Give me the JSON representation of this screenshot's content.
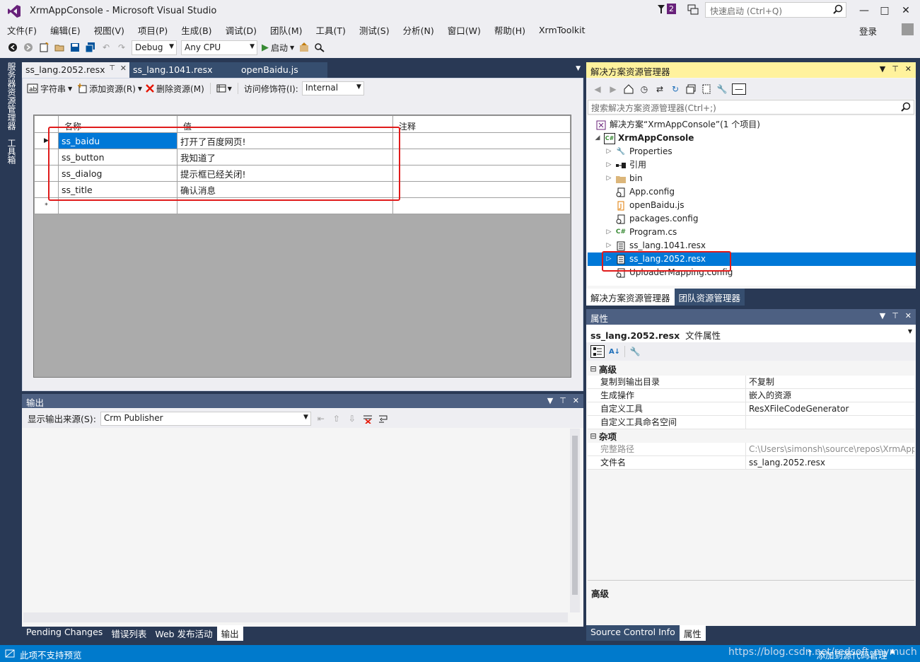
{
  "window": {
    "title": "XrmAppConsole - Microsoft Visual Studio",
    "notification_count": "2",
    "quick_launch_placeholder": "快速启动 (Ctrl+Q)",
    "login": "登录"
  },
  "menu": [
    "文件(F)",
    "编辑(E)",
    "视图(V)",
    "项目(P)",
    "生成(B)",
    "调试(D)",
    "团队(M)",
    "工具(T)",
    "测试(S)",
    "分析(N)",
    "窗口(W)",
    "帮助(H)",
    "XrmToolkit"
  ],
  "toolbar": {
    "config": "Debug",
    "platform": "Any CPU",
    "start_label": "启动"
  },
  "side_tabs": [
    "服务器资源管理器",
    "工具箱"
  ],
  "doc_tabs": [
    {
      "label": "ss_lang.2052.resx",
      "active": true
    },
    {
      "label": "ss_lang.1041.resx",
      "active": false
    },
    {
      "label": "openBaidu.js",
      "active": false
    }
  ],
  "resx_toolbar": {
    "strings": "字符串",
    "add_resource": "添加资源(R)",
    "remove_resource": "删除资源(M)",
    "access_modifier_label": "访问修饰符(I):",
    "access_modifier_value": "Internal"
  },
  "resx_grid": {
    "columns": [
      "名称",
      "值",
      "注释"
    ],
    "rows": [
      {
        "name": "ss_baidu",
        "value": "打开了百度网页!",
        "comment": ""
      },
      {
        "name": "ss_button",
        "value": "我知道了",
        "comment": ""
      },
      {
        "name": "ss_dialog",
        "value": "提示框已经关闭!",
        "comment": ""
      },
      {
        "name": "ss_title",
        "value": "确认消息",
        "comment": ""
      }
    ],
    "new_row_marker": "*"
  },
  "output": {
    "title": "输出",
    "source_label": "显示输出来源(S):",
    "source_value": "Crm Publisher"
  },
  "bottom_tabs": [
    "Pending Changes",
    "错误列表",
    "Web 发布活动",
    "输出"
  ],
  "solution_explorer": {
    "title": "解决方案资源管理器",
    "search_placeholder": "搜索解决方案资源管理器(Ctrl+;)",
    "solution": "解决方案“XrmAppConsole”(1 个项目)",
    "project": "XrmAppConsole",
    "items": [
      "Properties",
      "引用",
      "bin",
      "App.config",
      "openBaidu.js",
      "packages.config",
      "Program.cs",
      "ss_lang.1041.resx",
      "ss_lang.2052.resx",
      "UploaderMapping.config"
    ],
    "tabs": [
      "解决方案资源管理器",
      "团队资源管理器"
    ]
  },
  "properties": {
    "title": "属性",
    "object": "ss_lang.2052.resx",
    "object_type": "文件属性",
    "categories": [
      {
        "name": "高级",
        "rows": [
          {
            "name": "复制到输出目录",
            "value": "不复制"
          },
          {
            "name": "生成操作",
            "value": "嵌入的资源"
          },
          {
            "name": "自定义工具",
            "value": "ResXFileCodeGenerator"
          },
          {
            "name": "自定义工具命名空间",
            "value": ""
          }
        ]
      },
      {
        "name": "杂项",
        "rows": [
          {
            "name": "完整路径",
            "value": "C:\\Users\\simonsh\\source\\repos\\XrmApp"
          },
          {
            "name": "文件名",
            "value": "ss_lang.2052.resx"
          }
        ]
      }
    ],
    "description": "高级",
    "tabs": [
      "Source Control Info",
      "属性"
    ]
  },
  "status": {
    "text": "此项不支持预览",
    "publish": "添加到源代码管理",
    "watermark": "https://blog.csdn.net/redsoft_mymuch"
  },
  "colors": {
    "accent": "#007acc",
    "frame": "#293955",
    "selection": "#0078d7",
    "highlight": "#e01b1b",
    "active_header": "#fff29d"
  }
}
